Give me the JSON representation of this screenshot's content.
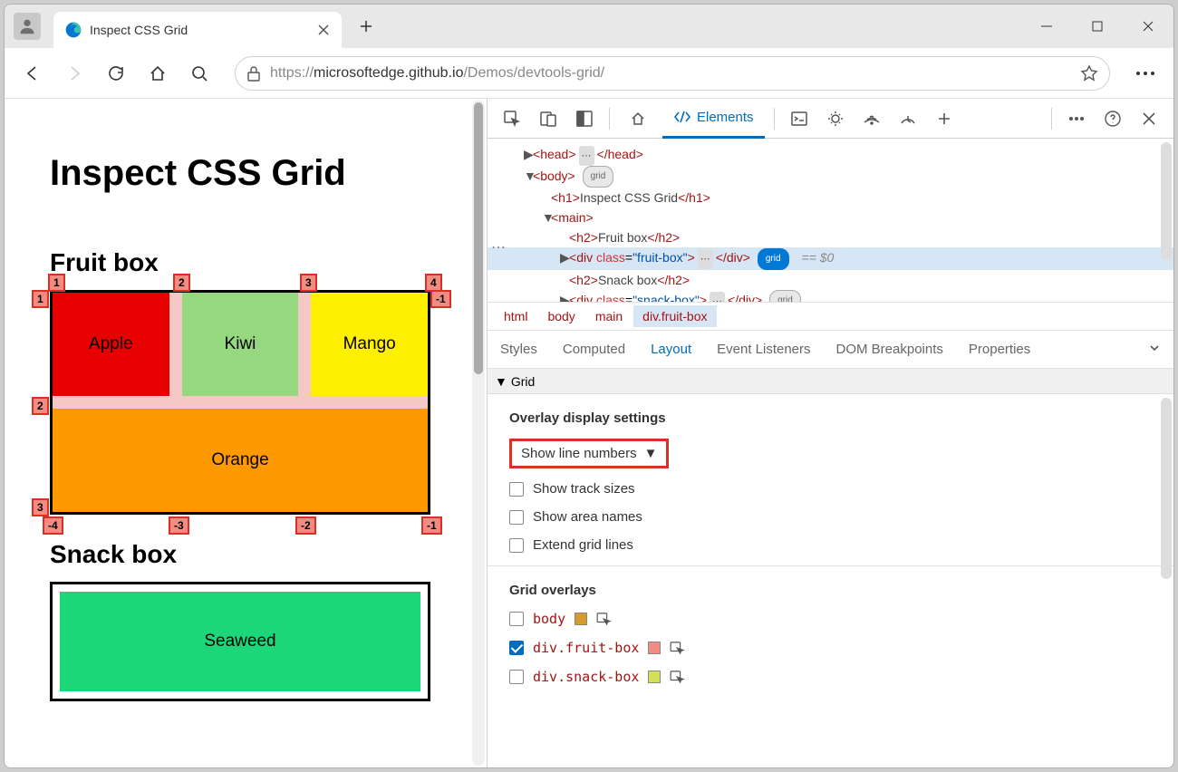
{
  "tab": {
    "title": "Inspect CSS Grid"
  },
  "url": {
    "host": "microsoftedge.github.io",
    "prefix": "https://",
    "path": "/Demos/devtools-grid/"
  },
  "page": {
    "h1": "Inspect CSS Grid",
    "h2a": "Fruit box",
    "h2b": "Snack box",
    "fruits": {
      "apple": "Apple",
      "kiwi": "Kiwi",
      "mango": "Mango",
      "orange": "Orange"
    },
    "snack": {
      "seaweed": "Seaweed"
    },
    "top_labels": [
      "1",
      "2",
      "3",
      "4"
    ],
    "left_labels": [
      "1",
      "2",
      "3"
    ],
    "right_labels": [
      "-1"
    ],
    "bottom_labels": [
      "-4",
      "-3",
      "-2",
      "-1"
    ]
  },
  "devtools": {
    "tab_elements": "Elements",
    "dom": {
      "head": "head",
      "body": "body",
      "h1txt": "Inspect CSS Grid",
      "main": "main",
      "h2a": "Fruit box",
      "h2b": "Snack box",
      "div": "div",
      "class": "class",
      "fruitbox": "\"fruit-box\"",
      "snackbox": "\"snack-box\"",
      "grid": "grid",
      "eq": "== $0"
    },
    "breadcrumb": [
      "html",
      "body",
      "main",
      "div.fruit-box"
    ],
    "panels": [
      "Styles",
      "Computed",
      "Layout",
      "Event Listeners",
      "DOM Breakpoints",
      "Properties"
    ],
    "section": "Grid",
    "overlay_hdr": "Overlay display settings",
    "dropdown": "Show line numbers",
    "chk1": "Show track sizes",
    "chk2": "Show area names",
    "chk3": "Extend grid lines",
    "overlays_hdr": "Grid overlays",
    "ov1": "body",
    "ov2": "div.fruit-box",
    "ov3": "div.snack-box"
  }
}
